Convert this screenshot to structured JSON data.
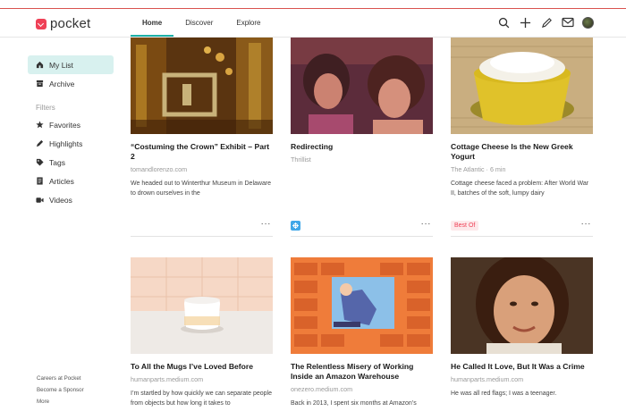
{
  "header": {
    "logo_text": "pocket",
    "tabs": [
      "Home",
      "Discover",
      "Explore"
    ],
    "icons": [
      "search-icon",
      "add-icon",
      "highlight-pen-icon",
      "inbox-icon",
      "avatar"
    ]
  },
  "sidebar": {
    "items": [
      {
        "label": "My List",
        "icon": "home-icon"
      },
      {
        "label": "Archive",
        "icon": "archive-icon"
      }
    ],
    "filters_label": "Filters",
    "filters": [
      {
        "label": "Favorites",
        "icon": "star-icon"
      },
      {
        "label": "Highlights",
        "icon": "highlight-icon"
      },
      {
        "label": "Tags",
        "icon": "tag-icon"
      },
      {
        "label": "Articles",
        "icon": "article-icon"
      },
      {
        "label": "Videos",
        "icon": "video-icon"
      }
    ],
    "footer": [
      "Careers at Pocket",
      "Become a Sponsor",
      "More"
    ]
  },
  "cards": [
    {
      "title": "“Costuming the Crown” Exhibit – Part 2",
      "source": "tomandlorenzo.com",
      "excerpt": "We headed out to Winterthur Museum in Delaware to drown ourselves in the",
      "badge": ""
    },
    {
      "title": "Redirecting",
      "source": "Thrillist",
      "excerpt": "",
      "badge": ""
    },
    {
      "title": "Cottage Cheese Is the New Greek Yogurt",
      "source": "The Atlantic · 6 min",
      "excerpt": "Cottage cheese faced a problem: After World War II, batches of the soft, lumpy dairy",
      "badge": "Best Of"
    },
    {
      "title": "To All the Mugs I’ve Loved Before",
      "source": "humanparts.medium.com",
      "excerpt": "I’m startled by how quickly we can separate people from objects but how long it takes to",
      "badge": ""
    },
    {
      "title": "The Relentless Misery of Working Inside an Amazon Warehouse",
      "source": "onezero.medium.com",
      "excerpt": "Back in 2013, I spent six months at Amazon’s",
      "badge": ""
    },
    {
      "title": "He Called It Love, But It Was a Crime",
      "source": "humanparts.medium.com",
      "excerpt": "He was all red flags; I was a teenager.",
      "badge": ""
    }
  ],
  "colors": {
    "accent": "#1cb0a8",
    "brand": "#ef4056"
  }
}
